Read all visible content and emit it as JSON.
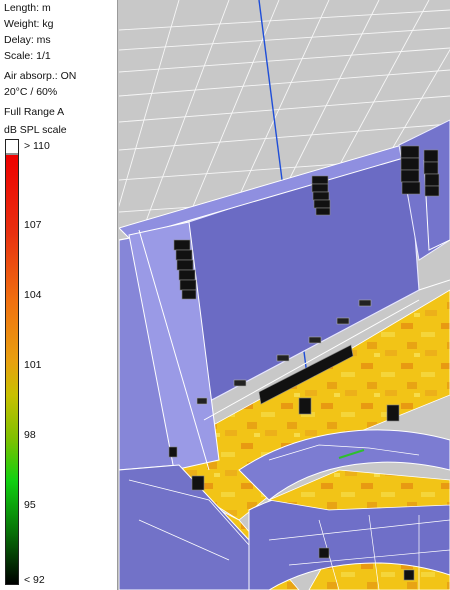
{
  "info": {
    "length_unit": "Length: m",
    "weight_unit": "Weight: kg",
    "delay_unit": "Delay: ms",
    "scale": "Scale: 1/1",
    "air_absorption": "Air absorp.: ON",
    "conditions": "20°C / 60%",
    "range": "Full Range A"
  },
  "legend": {
    "title": "dB SPL scale",
    "labels": [
      "> 110",
      "107",
      "104",
      "101",
      "98",
      "95",
      "< 92"
    ]
  },
  "colors": {
    "panel_bg": "#ffffff",
    "viewport_bg": "#c8c8c8",
    "hall_walls": "#6b6bc4",
    "hall_edges": "#e6e6ff",
    "floor_spl": "#f3c21a",
    "axis_z": "#1f4ed8",
    "axis_x": "#c81e1e",
    "axis_y": "#2fbf2f"
  }
}
